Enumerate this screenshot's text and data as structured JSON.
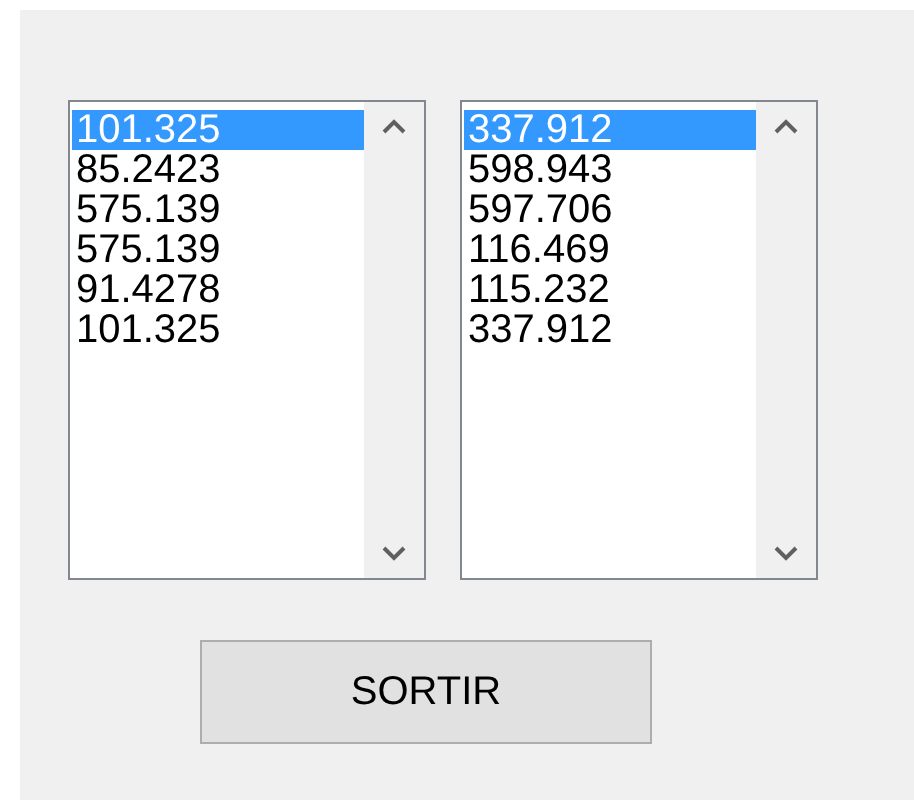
{
  "lists": [
    {
      "items": [
        {
          "text": "101.325",
          "selected": true
        },
        {
          "text": "85.2423",
          "selected": false
        },
        {
          "text": "575.139",
          "selected": false
        },
        {
          "text": "575.139",
          "selected": false
        },
        {
          "text": "91.4278",
          "selected": false
        },
        {
          "text": "101.325",
          "selected": false
        }
      ]
    },
    {
      "items": [
        {
          "text": "337.912",
          "selected": true
        },
        {
          "text": "598.943",
          "selected": false
        },
        {
          "text": "597.706",
          "selected": false
        },
        {
          "text": "116.469",
          "selected": false
        },
        {
          "text": "115.232",
          "selected": false
        },
        {
          "text": "337.912",
          "selected": false
        }
      ]
    }
  ],
  "button": {
    "label": "SORTIR"
  }
}
